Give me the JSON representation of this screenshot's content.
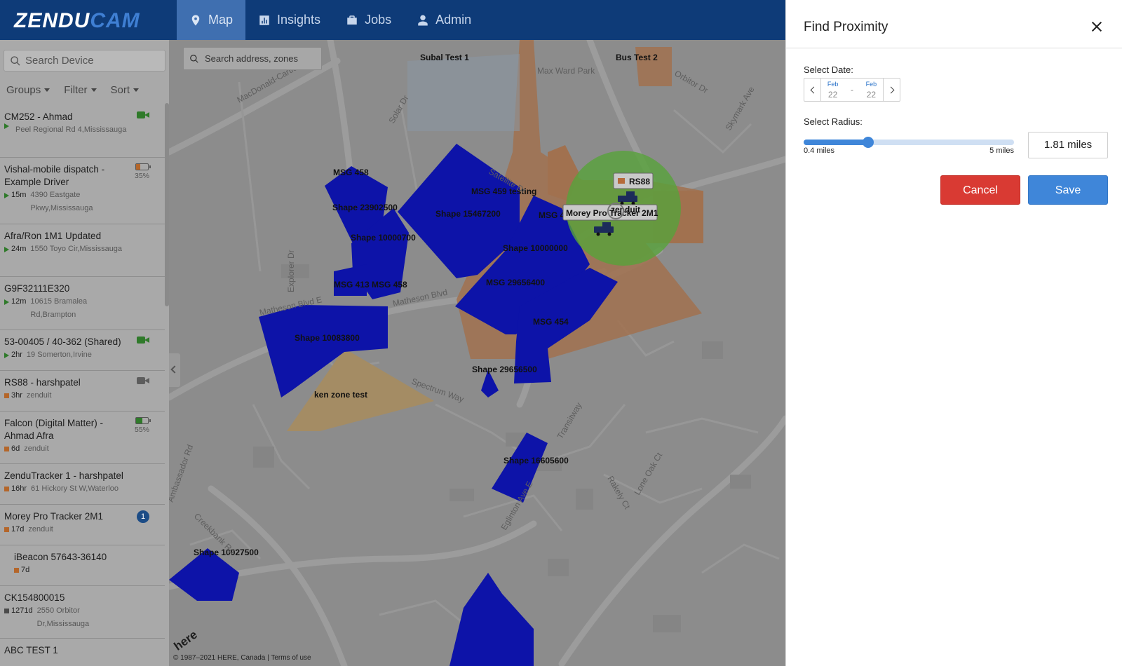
{
  "app": {
    "logo_part1": "ZENDU",
    "logo_part2": "CAM"
  },
  "nav": [
    {
      "label": "Map",
      "icon": "map-pin-icon",
      "active": true
    },
    {
      "label": "Insights",
      "icon": "bar-chart-icon",
      "active": false
    },
    {
      "label": "Jobs",
      "icon": "briefcase-icon",
      "active": false
    },
    {
      "label": "Admin",
      "icon": "user-icon",
      "active": false
    }
  ],
  "sidebar": {
    "search_placeholder": "Search Device",
    "filters": [
      "Groups",
      "Filter",
      "Sort"
    ],
    "devices": [
      {
        "name": "CM252 - Ahmad",
        "age": "",
        "status": "moving",
        "address": "Peel Regional Rd 4,Mississauga",
        "icon": "camera-icon",
        "icon_color": "#2f7a2a"
      },
      {
        "name": "Vishal-mobile dispatch - Example Driver",
        "age": "15m",
        "status": "moving",
        "address": "4390 Eastgate Pkwy,Mississauga",
        "battery": "35%",
        "battery_level": 0.35
      },
      {
        "name": "Afra/Ron 1M1 Updated",
        "age": "24m",
        "status": "moving",
        "address": "1550 Toyo Cir,Mississauga"
      },
      {
        "name": "G9F32111E320",
        "age": "12m",
        "status": "moving",
        "address": "10615 Bramalea Rd,Brampton"
      },
      {
        "name": "53-00405 / 40-362 (Shared)",
        "age": "2hr",
        "status": "moving",
        "address": "19 Somerton,Irvine",
        "icon": "camera-icon",
        "icon_color": "#2f7a2a"
      },
      {
        "name": "RS88 - harshpatel",
        "age": "3hr",
        "status": "stopped",
        "address": "zenduit",
        "icon": "camera-icon",
        "icon_color": "#5d5d5d"
      },
      {
        "name": "Falcon (Digital Matter) - Ahmad Afra",
        "age": "6d",
        "status": "stopped",
        "address": "zenduit",
        "battery": "55%",
        "battery_level": 0.55
      },
      {
        "name": "ZenduTracker 1 - harshpatel",
        "age": "16hr",
        "status": "stopped",
        "address": "61 Hickory St W,Waterloo"
      },
      {
        "name": "Morey Pro Tracker 2M1",
        "age": "17d",
        "status": "stopped",
        "address": "zenduit",
        "badge": "1"
      },
      {
        "name": "iBeacon 57643-36140",
        "age": "7d",
        "status": "stopped",
        "address": "",
        "indent": true
      },
      {
        "name": "CK154800015",
        "age": "1271d",
        "status": "offline",
        "address": "2550 Orbitor Dr,Mississauga"
      },
      {
        "name": "ABC TEST 1",
        "age": "",
        "status": "",
        "address": ""
      }
    ]
  },
  "map": {
    "search_placeholder": "Search address, zones",
    "footer": "© 1987–2021 HERE, Canada | Terms of use",
    "here_logo": "here",
    "zones": [
      "Subal Test 1",
      "Bus Test 2",
      "MSG 458",
      "MSG 459 testing",
      "Shape 23902500",
      "Shape 15467200",
      "MSG 456",
      "Shape 10000700",
      "Shape 10000000",
      "MSG 413 MSG 458",
      "MSG 29656400",
      "MSG 454",
      "Shape 10083800",
      "ken zone test",
      "Shape 29656500",
      "Shape 16605600",
      "Shape 10027500"
    ],
    "roads": [
      "Matheson Blvd E",
      "MacDonald-Cartier Fwy",
      "Explorer Dr",
      "Solar Dr",
      "Satellite Dr",
      "Orbitor Dr",
      "Skymark Ave",
      "Transitway",
      "Eglinton Ave E",
      "Spectrum Way",
      "Creekbank Rd",
      "Rakely Ct",
      "Lone Oak Ct",
      "Matheson Blvd",
      "Ambassador Rd",
      "Max Ward Park"
    ],
    "vehicles": [
      "RS88",
      "Morey Pro Tracker 2M1",
      "zenduit"
    ]
  },
  "panel": {
    "title": "Find Proximity",
    "date_label": "Select Date:",
    "date_from": {
      "month": "Feb",
      "day": "22"
    },
    "date_to": {
      "month": "Feb",
      "day": "22"
    },
    "date_separator": "-",
    "radius_label": "Select Radius:",
    "radius_min": "0.4 miles",
    "radius_max": "5 miles",
    "radius_value": "1.81 miles",
    "radius_fraction": 0.306,
    "cancel_label": "Cancel",
    "save_label": "Save"
  }
}
